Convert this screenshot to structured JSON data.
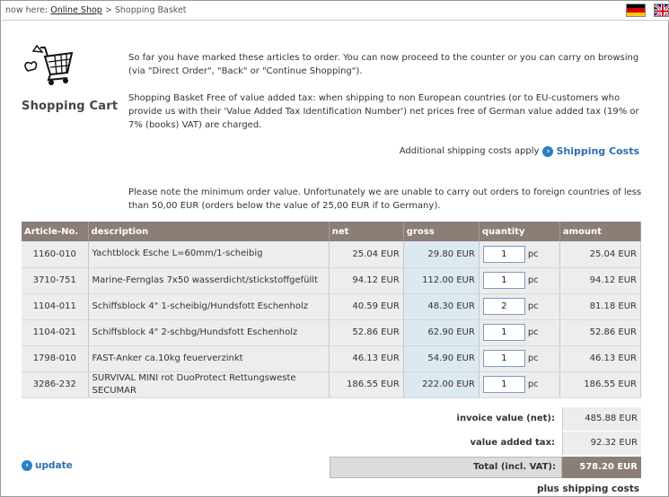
{
  "breadcrumb": {
    "prefix": "now here:",
    "shop_link": "Online Shop",
    "separator": ">",
    "current": "Shopping Basket"
  },
  "languages": [
    "german-flag-icon",
    "uk-flag-icon"
  ],
  "cart_title": "Shopping Cart",
  "intro": "So far you have marked these articles to order. You can now proceed to the counter or you can carry on browsing (via \"Direct Order\", \"Back\" or \"Continue Shopping\").",
  "vat_note": "Shopping Basket Free of value added tax: when shipping to non European countries (or to EU-customers who provide us with their 'Value Added Tax Identification Number') net prices free of German value added tax (19% or 7% (books) VAT) are charged.",
  "shipping": {
    "text": "Additional shipping costs apply",
    "link": "Shipping Costs"
  },
  "min_order_note": "Please note the minimum order value. Unfortunately we are unable to carry out orders to foreign countries of less than 50,00 EUR (orders below the value of 25,00 EUR if to Germany).",
  "table": {
    "headers": {
      "article": "Article-No.",
      "description": "description",
      "net": "net",
      "gross": "gross",
      "quantity": "quantity",
      "amount": "amount"
    },
    "unit": "pc",
    "rows": [
      {
        "article": "1160-010",
        "description": "Yachtblock Esche L=60mm/1-scheibig",
        "net": "25.04 EUR",
        "gross": "29.80 EUR",
        "qty": "1",
        "amount": "25.04 EUR"
      },
      {
        "article": "3710-751",
        "description": "Marine-Fernglas 7x50 wasserdicht/stickstoffgefüllt",
        "net": "94.12 EUR",
        "gross": "112.00 EUR",
        "qty": "1",
        "amount": "94.12 EUR"
      },
      {
        "article": "1104-011",
        "description": "Schiffsblock 4\" 1-scheibig/Hundsfott Eschenholz",
        "net": "40.59 EUR",
        "gross": "48.30 EUR",
        "qty": "2",
        "amount": "81.18 EUR"
      },
      {
        "article": "1104-021",
        "description": "Schiffsblock 4\" 2-schbg/Hundsfott Eschenholz",
        "net": "52.86 EUR",
        "gross": "62.90 EUR",
        "qty": "1",
        "amount": "52.86 EUR"
      },
      {
        "article": "1798-010",
        "description": "FAST-Anker ca.10kg feuerverzinkt",
        "net": "46.13 EUR",
        "gross": "54.90 EUR",
        "qty": "1",
        "amount": "46.13 EUR"
      },
      {
        "article": "3286-232",
        "description": "SURVIVAL MINI rot DuoProtect Rettungsweste SECUMAR",
        "net": "186.55 EUR",
        "gross": "222.00 EUR",
        "qty": "1",
        "amount": "186.55 EUR"
      }
    ]
  },
  "totals": {
    "invoice_label": "invoice value (net):",
    "invoice_value": "485.88 EUR",
    "vat_label": "value added tax:",
    "vat_value": "92.32 EUR",
    "total_label": "Total (incl. VAT):",
    "total_value": "578.20 EUR"
  },
  "update_label": "update",
  "plus_shipping": "plus shipping costs",
  "colors": {
    "header_bg": "#8a7e76",
    "link": "#2d6fb0",
    "gross_bg": "#dde9f1",
    "row_bg": "#ededed"
  }
}
